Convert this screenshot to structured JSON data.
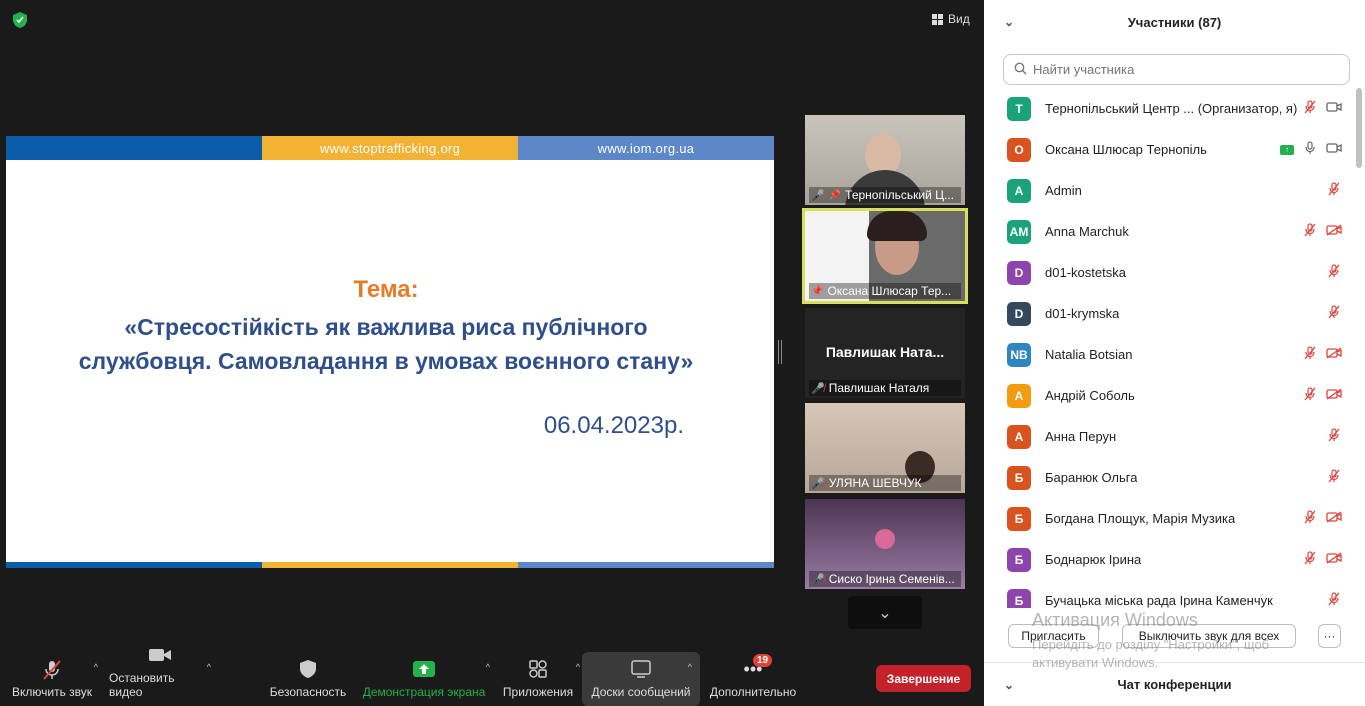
{
  "top": {
    "view_label": "Вид"
  },
  "slide": {
    "bar": [
      "",
      "www.stoptrafficking.org",
      "www.iom.org.ua"
    ],
    "topic": "Тема:",
    "title": "«Стресостійкість як важлива риса публічного службовця. Самовладання в умовах воєнного стану»",
    "date": "06.04.2023р."
  },
  "thumbnails": [
    {
      "name": "Тернопільський Ц..."
    },
    {
      "name": "Оксана Шлюсар Тер..."
    },
    {
      "big_name": "Павлишак  Ната...",
      "name": "Павлишак Наталя"
    },
    {
      "name": "УЛЯНА ШЕВЧУК"
    },
    {
      "name": "Сиско Ірина Семенів..."
    }
  ],
  "toolbar": {
    "unmute": "Включить звук",
    "stop_video": "Остановить видео",
    "security": "Безопасность",
    "share": "Демонстрация экрана",
    "apps": "Приложения",
    "whiteboards": "Доски сообщений",
    "more": "Дополнительно",
    "more_badge": "19",
    "end": "Завершение"
  },
  "panel": {
    "title": "Участники (87)",
    "search_placeholder": "Найти участника",
    "participants": [
      {
        "initials": "T",
        "color": "#1aa37a",
        "name": "Тернопільський Центр ... (Организатор, я)",
        "icons": [
          "mic-off",
          "video"
        ]
      },
      {
        "initials": "O",
        "color": "#d9531e",
        "name": "Оксана Шлюсар Тернопіль",
        "icons": [
          "share",
          "mic",
          "video"
        ]
      },
      {
        "initials": "A",
        "color": "#1aa37a",
        "name": "Admin",
        "icons": [
          "mic-off"
        ]
      },
      {
        "initials": "AM",
        "color": "#1aa37a",
        "name": "Anna Marchuk",
        "icons": [
          "mic-off",
          "video-off"
        ]
      },
      {
        "initials": "D",
        "color": "#8e44ad",
        "name": "d01-kostetska",
        "icons": [
          "mic-off"
        ]
      },
      {
        "initials": "D",
        "color": "#34495e",
        "name": "d01-krymska",
        "icons": [
          "mic-off"
        ]
      },
      {
        "initials": "NB",
        "color": "#2e86c1",
        "name": "Natalia Botsian",
        "icons": [
          "mic-off",
          "video-off"
        ]
      },
      {
        "initials": "A",
        "color": "#f39c12",
        "name": "Андрій Соболь",
        "icons": [
          "mic-off",
          "video-off"
        ]
      },
      {
        "initials": "A",
        "color": "#d9531e",
        "name": "Анна Перун",
        "icons": [
          "mic-off"
        ]
      },
      {
        "initials": "Б",
        "color": "#d9531e",
        "name": "Баранюк Ольга",
        "icons": [
          "mic-off"
        ]
      },
      {
        "initials": "Б",
        "color": "#d9531e",
        "name": "Богдана Площук, Марія Музика",
        "icons": [
          "mic-off",
          "video-off"
        ]
      },
      {
        "initials": "Б",
        "color": "#8e44ad",
        "name": "Боднарюк Ірина",
        "icons": [
          "mic-off",
          "video-off"
        ]
      },
      {
        "initials": "Б",
        "color": "#8e44ad",
        "name": "Бучацька міська рада Ірина Каменчук",
        "icons": [
          "mic-off"
        ]
      }
    ],
    "invite": "Пригласить",
    "unmute_all": "Выключить звук для всех",
    "more": "···",
    "chat_title": "Чат конференции"
  },
  "watermark": {
    "title": "Активация Windows",
    "text": "Перейдіть до розділу \"Настройки\", щоб активувати Windows."
  }
}
